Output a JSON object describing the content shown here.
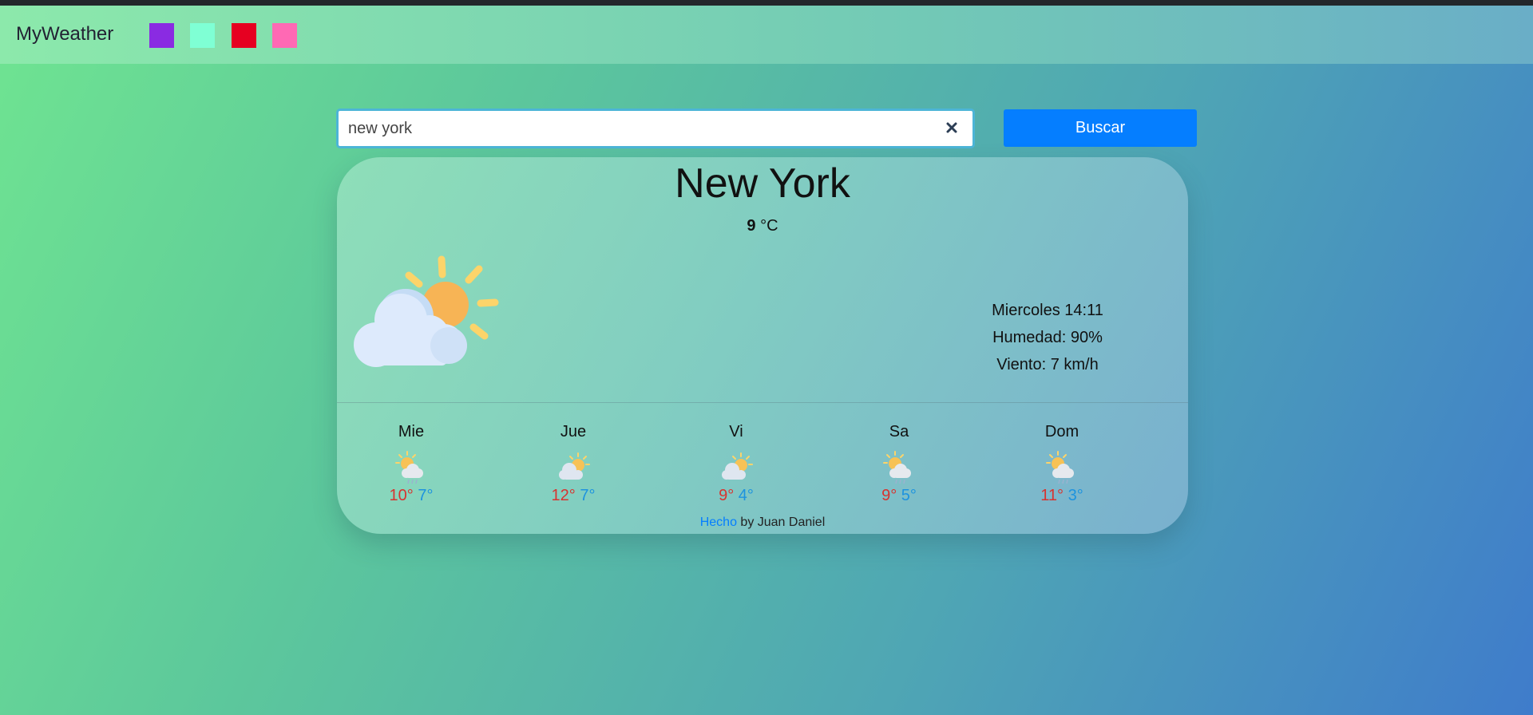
{
  "navbar": {
    "brand": "MyWeather",
    "themes": [
      {
        "name": "theme-purple",
        "color": "#8a2be2"
      },
      {
        "name": "theme-aquamarine",
        "color": "#7fffd4"
      },
      {
        "name": "theme-red",
        "color": "#e60021"
      },
      {
        "name": "theme-pink",
        "color": "#ff69b4"
      }
    ]
  },
  "search": {
    "value": "new york",
    "button_label": "Buscar",
    "clear_icon": "close-icon"
  },
  "weather": {
    "city": "New York",
    "temperature": "9",
    "unit": "°C",
    "icon": "sun-behind-cloud-icon",
    "datetime": "Miercoles 14:11",
    "humidity": "Humedad: 90%",
    "wind": "Viento: 7 km/h"
  },
  "forecast": [
    {
      "day": "Mie",
      "max": "10°",
      "min": "7°",
      "icon": "sun-cloud-rain-icon"
    },
    {
      "day": "Jue",
      "max": "12°",
      "min": "7°",
      "icon": "sun-cloud-icon"
    },
    {
      "day": "Vi",
      "max": "9°",
      "min": "4°",
      "icon": "sun-cloud-icon"
    },
    {
      "day": "Sa",
      "max": "9°",
      "min": "5°",
      "icon": "sun-cloud-rain-icon"
    },
    {
      "day": "Dom",
      "max": "11°",
      "min": "3°",
      "icon": "sun-cloud-rain-icon"
    }
  ],
  "footer": {
    "link": "Hecho",
    "text": " by Juan Daniel"
  },
  "colors": {
    "accent": "#057eff",
    "max_temp": "#d8332f",
    "min_temp": "#1d93df"
  }
}
